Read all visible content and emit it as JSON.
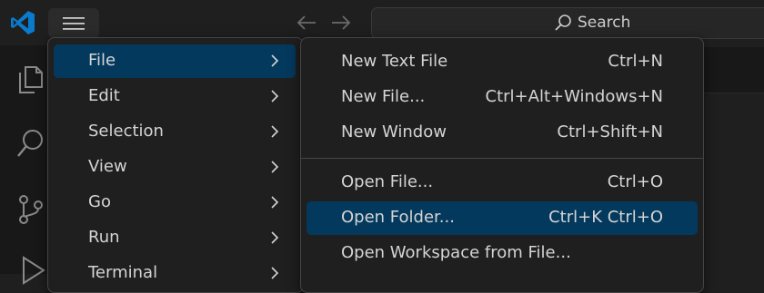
{
  "search": {
    "label": "Search"
  },
  "menu": {
    "items": [
      {
        "label": "File"
      },
      {
        "label": "Edit"
      },
      {
        "label": "Selection"
      },
      {
        "label": "View"
      },
      {
        "label": "Go"
      },
      {
        "label": "Run"
      },
      {
        "label": "Terminal"
      }
    ],
    "active": "File"
  },
  "file_submenu": {
    "items": [
      {
        "label": "New Text File",
        "shortcut": "Ctrl+N"
      },
      {
        "label": "New File...",
        "shortcut": "Ctrl+Alt+Windows+N"
      },
      {
        "label": "New Window",
        "shortcut": "Ctrl+Shift+N"
      },
      {
        "label": "Open File...",
        "shortcut": "Ctrl+O"
      },
      {
        "label": "Open Folder...",
        "shortcut": "Ctrl+K Ctrl+O"
      },
      {
        "label": "Open Workspace from File...",
        "shortcut": ""
      }
    ],
    "highlighted": "Open Folder..."
  },
  "icons": {
    "logo": "vscode-logo",
    "menu": "hamburger-icon",
    "back": "arrow-left-icon",
    "forward": "arrow-right-icon",
    "search": "search-icon",
    "explorer": "files-icon",
    "search_view": "search-icon",
    "source_control": "source-control-icon",
    "run": "run-debug-icon"
  },
  "colors": {
    "background": "#1f1f1f",
    "activity_bar": "#181818",
    "menu_highlight": "#04395e",
    "accent": "#0078d4"
  }
}
